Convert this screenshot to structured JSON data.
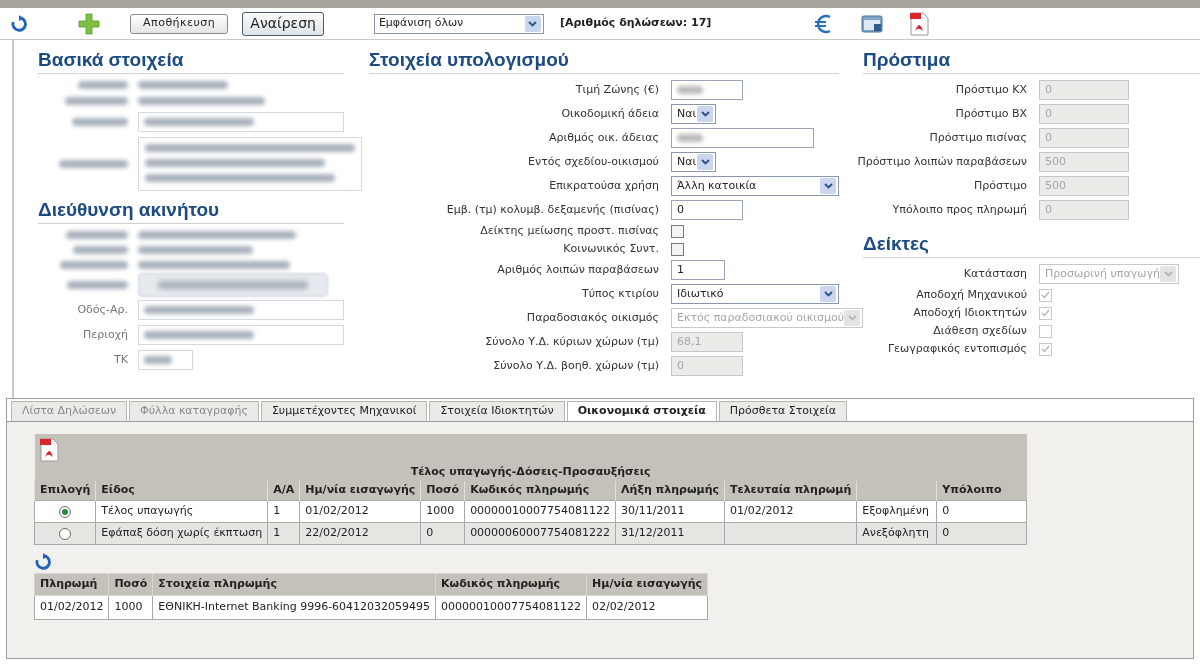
{
  "toolbar": {
    "save_label": "Αποθήκευση",
    "undo_label": "Αναίρεση",
    "filter": {
      "value": "Εμφάνιση όλων"
    },
    "count": "[Αριθμός δηλώσεων: 17]"
  },
  "basic": {
    "title": "Βασικά στοιχεία",
    "rows": [
      {
        "kind": "line"
      },
      {
        "kind": "line"
      },
      {
        "kind": "input"
      },
      {
        "kind": "textarea"
      }
    ]
  },
  "address": {
    "title": "Διεύθυνση ακινήτου",
    "rows": [
      {
        "kind": "line"
      },
      {
        "kind": "line"
      },
      {
        "kind": "line"
      },
      {
        "kind": "button"
      },
      {
        "kind": "input",
        "label": "Οδός-Αρ."
      },
      {
        "kind": "input",
        "label": "Περιοχή"
      },
      {
        "kind": "short",
        "label": "ΤΚ"
      }
    ]
  },
  "calc": {
    "title": "Στοιχεία υπολογισμού",
    "fields": [
      {
        "label": "Τιμή Ζώνης (€)",
        "kind": "input",
        "blurred": true,
        "disabled": false
      },
      {
        "label": "Οικοδομική άδεια",
        "kind": "select",
        "value": "Ναι",
        "disabled": false
      },
      {
        "label": "Αριθμός οικ. άδειας",
        "kind": "input",
        "blurred": true,
        "disabled": false
      },
      {
        "label": "Εντός σχεδίου-οικισμού",
        "kind": "select",
        "value": "Ναι",
        "disabled": false
      },
      {
        "label": "Επικρατούσα χρήση",
        "kind": "select",
        "value": "Άλλη κατοικία",
        "disabled": false
      },
      {
        "label": "Εμβ. (τμ) κολυμβ. δεξαμενής (πισίνας)",
        "kind": "input",
        "value": "0",
        "disabled": false
      },
      {
        "label": "Δείκτης μείωσης προστ. πισίνας",
        "kind": "checkbox",
        "checked": false,
        "disabled": false
      },
      {
        "label": "Κοινωνικός Συντ.",
        "kind": "checkbox",
        "checked": false,
        "disabled": false
      },
      {
        "label": "Αριθμός λοιπών παραβάσεων",
        "kind": "input",
        "value": "1",
        "disabled": false
      },
      {
        "label": "Τύπος κτιρίου",
        "kind": "select",
        "value": "Ιδιωτικό",
        "disabled": false
      },
      {
        "label": "Παραδοσιακός οικισμός",
        "kind": "select",
        "value": "Εκτός παραδοσιακού οικισμού",
        "disabled": true
      },
      {
        "label": "Σύνολο Υ.Δ. κύριων χώρων (τμ)",
        "kind": "input",
        "value": "68,1",
        "disabled": true
      },
      {
        "label": "Σύνολο Υ.Δ. βοηθ. χώρων (τμ)",
        "kind": "input",
        "value": "0",
        "disabled": true
      }
    ]
  },
  "fines": {
    "title": "Πρόστιμα",
    "fields": [
      {
        "label": "Πρόστιμο ΚΧ",
        "kind": "input",
        "value": "0",
        "disabled": true
      },
      {
        "label": "Πρόστιμο ΒΧ",
        "kind": "input",
        "value": "0",
        "disabled": true
      },
      {
        "label": "Πρόστιμο πισίνας",
        "kind": "input",
        "value": "0",
        "disabled": true
      },
      {
        "label": "Πρόστιμο λοιπών παραβάσεων",
        "kind": "input",
        "value": "500",
        "disabled": true
      },
      {
        "label": "Πρόστιμο",
        "kind": "input",
        "value": "500",
        "disabled": true
      },
      {
        "label": "Υπόλοιπο προς πληρωμή",
        "kind": "input",
        "value": "0",
        "disabled": true
      }
    ]
  },
  "indicators": {
    "title": "Δείκτες",
    "fields": [
      {
        "label": "Κατάσταση",
        "kind": "select",
        "value": "Προσωρινή υπαγωγή",
        "disabled": true
      },
      {
        "label": "Αποδοχή Μηχανικού",
        "kind": "checkbox",
        "checked": true,
        "disabled": true
      },
      {
        "label": "Αποδοχή Ιδιοκτητών",
        "kind": "checkbox",
        "checked": true,
        "disabled": true
      },
      {
        "label": "Διάθεση σχεδίων",
        "kind": "checkbox",
        "checked": false,
        "disabled": true
      },
      {
        "label": "Γεωγραφικός εντοπισμός",
        "kind": "checkbox",
        "checked": true,
        "disabled": true
      }
    ]
  },
  "tabs": [
    {
      "label": "Λίστα Δηλώσεων",
      "selected": false,
      "disabled": true
    },
    {
      "label": "Φύλλα καταγραφής",
      "selected": false,
      "disabled": true
    },
    {
      "label": "Συμμετέχοντες Μηχανικοί",
      "selected": false,
      "disabled": false
    },
    {
      "label": "Στοιχεία Ιδιοκτητών",
      "selected": false,
      "disabled": false
    },
    {
      "label": "Οικονομικά στοιχεία",
      "selected": true,
      "disabled": false
    },
    {
      "label": "Πρόσθετα Στοιχεία",
      "selected": false,
      "disabled": false
    }
  ],
  "fees_table": {
    "title": "Τέλος υπαγωγής-Δόσεις-Προσαυξήσεις",
    "columns": [
      "Επιλογή",
      "Είδος",
      "Α/Α",
      "Ημ/νία εισαγωγής",
      "Ποσό",
      "Κωδικός πληρωμής",
      "Λήξη πληρωμής",
      "Τελευταία πληρωμή",
      "",
      "Υπόλοιπο"
    ],
    "rows": [
      {
        "selected": true,
        "cells": [
          "",
          "Τέλος υπαγωγής",
          "1",
          "01/02/2012",
          "1000",
          "00000010007754081122",
          "30/11/2011",
          "01/02/2012",
          "Εξοφλημένη",
          "0"
        ]
      },
      {
        "selected": false,
        "cells": [
          "",
          "Εφάπαξ δόση χωρίς έκπτωση",
          "1",
          "22/02/2012",
          "0",
          "00000060007754081222",
          "31/12/2011",
          "",
          "Ανεξόφλητη",
          "0"
        ]
      }
    ]
  },
  "payments_table": {
    "columns": [
      "Πληρωμή",
      "Ποσό",
      "Στοιχεία πληρωμής",
      "Κωδικός πληρωμής",
      "Ημ/νία εισαγωγής"
    ],
    "rows": [
      [
        "01/02/2012",
        "1000",
        "ΕΘΝΙΚΗ-Internet Banking 9996-60412032059495",
        "00000010007754081122",
        "02/02/2012"
      ]
    ]
  }
}
